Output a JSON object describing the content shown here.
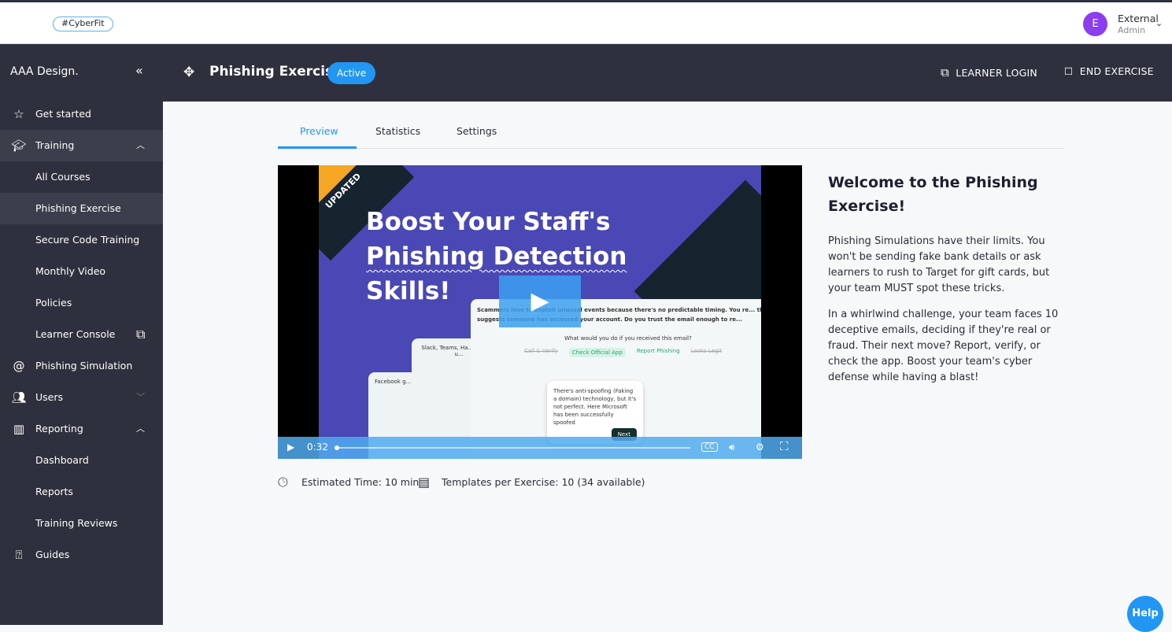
{
  "topbar": {
    "tag": "#CyberFit",
    "user": {
      "initial": "E",
      "name": "External",
      "role": "Admin"
    }
  },
  "sidebar": {
    "brand": "AAA Design.",
    "items": [
      {
        "label": "Get started",
        "icon": "star-icon"
      },
      {
        "label": "Training",
        "icon": "graduation-cap-icon"
      },
      {
        "label": "All Courses"
      },
      {
        "label": "Phishing Exercise"
      },
      {
        "label": "Secure Code Training"
      },
      {
        "label": "Monthly Video"
      },
      {
        "label": "Policies"
      },
      {
        "label": "Learner Console",
        "icon": "external-link-icon"
      },
      {
        "label": "Phishing Simulation",
        "icon": "at-icon"
      },
      {
        "label": "Users",
        "icon": "users-icon"
      },
      {
        "label": "Reporting",
        "icon": "bar-chart-icon"
      },
      {
        "label": "Dashboard"
      },
      {
        "label": "Reports"
      },
      {
        "label": "Training Reviews"
      },
      {
        "label": "Guides",
        "icon": "help-box-icon"
      }
    ]
  },
  "header": {
    "title": "Phishing Exercise",
    "status": "Active",
    "learner_login": "LEARNER LOGIN",
    "end_exercise": "END EXERCISE"
  },
  "tabs": [
    "Preview",
    "Statistics",
    "Settings"
  ],
  "video": {
    "badge": "UPDATED",
    "headline": [
      "Boost Your Staff's",
      "Phishing Detection",
      "Skills!"
    ],
    "card_text": "Scammers love to exploit unusual events because there's no predictable timing. You re... that suggests someone has accessed your account. Do you trust the email enough to re...",
    "question": "What would you do if you received this email?",
    "options": [
      "Call & Verify",
      "Check Official App",
      "Report Phishing",
      "Looks Legit"
    ],
    "tip": "There's anti-spoofing (Faking a domain) technology, but it's not perfect. Here Microsoft has been successfully spoofed",
    "next": "Next",
    "side_card1": "Slack, Teams, Ha... say you u...",
    "side_card2": "Facebook g...",
    "time": "0:32",
    "progress": 0.01
  },
  "meta": {
    "time": "Estimated Time: 10 min",
    "templates": "Templates per Exercise: 10 (34 available)"
  },
  "info": {
    "title": "Welcome to the Phishing Exercise!",
    "p1": "Phishing Simulations have their limits. You won't be sending fake bank details or ask learners to rush to Target for gift cards, but your team MUST spot these tricks.",
    "p2": "In a whirlwind challenge, your team faces 10 deceptive emails, deciding if they're real or fraud. Their next move? Report, verify, or check the app. Boost your team's cyber defense while having a blast!"
  },
  "help": "Help",
  "colors": {
    "accent": "#2196f3",
    "sidebar": "#2e313d",
    "avatar": "#8b3df0"
  }
}
